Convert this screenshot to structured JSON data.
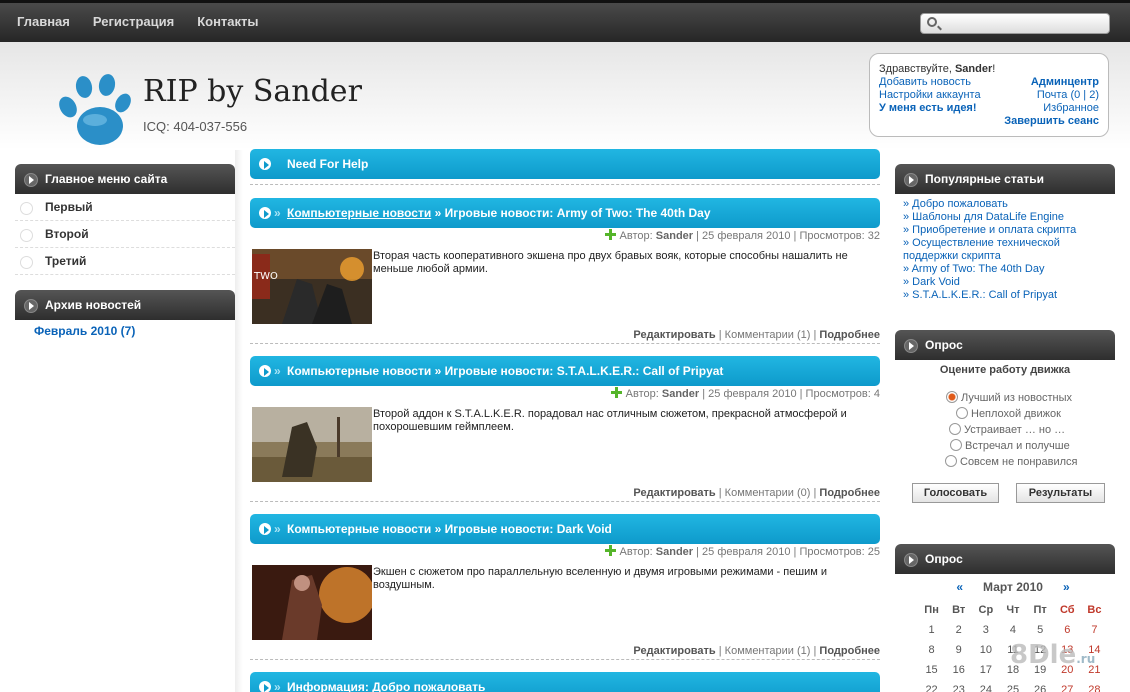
{
  "nav": {
    "items": [
      "Главная",
      "Регистрация",
      "Контакты"
    ],
    "search_placeholder": ""
  },
  "header": {
    "title": "RIP by Sander",
    "icq": "ICQ: 404-037-556"
  },
  "userbox": {
    "greeting": "Здравствуйте,",
    "user": "Sander",
    "excl": "!",
    "add_news": "Добавить новость",
    "account_settings": "Настройки аккаунта",
    "idea": "У меня есть идея!",
    "admin": "Админцентр",
    "mail": "Почта (0 | 2)",
    "favorites": "Избранное",
    "logout": "Завершить сеанс"
  },
  "left": {
    "main_menu_title": "Главное меню сайта",
    "menu": [
      "Первый",
      "Второй",
      "Третий"
    ],
    "archive_title": "Архив новостей",
    "archive_item": "Февраль 2010 (7)"
  },
  "center": {
    "need_help": "Need For Help",
    "posts": [
      {
        "category": "Компьютерные новости",
        "title": "» Игровые новости: Army of Two: The 40th Day",
        "author_label": "Автор:",
        "author": "Sander",
        "date": "| 25 февраля 2010 | Просмотров: 32",
        "text": "Вторая часть кооперативного экшена про двух бравых вояк, которые способны нашалить не меньше любой армии.",
        "edit": "Редактировать",
        "comments": "| Комментарии (1) |",
        "more": "Подробнее"
      },
      {
        "category": "Компьютерные новости",
        "title": "» Игровые новости: S.T.A.L.K.E.R.: Call of Pripyat",
        "author_label": "Автор:",
        "author": "Sander",
        "date": "| 25 февраля 2010 | Просмотров: 4",
        "text": "Второй аддон к S.T.A.L.K.E.R. порадовал нас отличным сюжетом, прекрасной атмосферой и похорошевшим геймплеем.",
        "edit": "Редактировать",
        "comments": "| Комментарии (0) |",
        "more": "Подробнее"
      },
      {
        "category": "Компьютерные новости",
        "title": "» Игровые новости: Dark Void",
        "author_label": "Автор:",
        "author": "Sander",
        "date": "| 25 февраля 2010 | Просмотров: 25",
        "text": "Экшен с сюжетом про параллельную вселенную и двумя игровыми режимами - пешим и воздушным.",
        "edit": "Редактировать",
        "comments": "| Комментарии (1) |",
        "more": "Подробнее"
      }
    ],
    "last_bar": "Информация: Добро пожаловать"
  },
  "right": {
    "popular_title": "Популярные статьи",
    "popular": [
      "» Добро пожаловать",
      "» Шаблоны для DataLife Engine",
      "» Приобретение и оплата скрипта",
      "» Осуществление технической поддержки скрипта",
      "» Army of Two: The 40th Day",
      "» Dark Void",
      "» S.T.A.L.K.E.R.: Call of Pripyat"
    ],
    "poll_title": "Опрос",
    "poll_question": "Оцените работу движка",
    "poll_options": [
      "Лучший из новостных",
      "Неплохой движок",
      "Устраивает … но …",
      "Встречал и получше",
      "Совсем не понравился"
    ],
    "vote": "Голосовать",
    "results": "Результаты",
    "calendar_title": "Опрос",
    "calendar": {
      "prev": "«",
      "month": "Март 2010",
      "next": "»",
      "days": [
        "Пн",
        "Вт",
        "Ср",
        "Чт",
        "Пт",
        "Сб",
        "Вс"
      ],
      "rows": [
        [
          "1",
          "2",
          "3",
          "4",
          "5",
          "6",
          "7"
        ],
        [
          "8",
          "9",
          "10",
          "11",
          "12",
          "13",
          "14"
        ],
        [
          "15",
          "16",
          "17",
          "18",
          "19",
          "20",
          "21"
        ],
        [
          "22",
          "23",
          "24",
          "25",
          "26",
          "27",
          "28"
        ]
      ]
    }
  },
  "watermark": {
    "text": "8Dle",
    "tld": ".ru"
  },
  "colors": {
    "accent": "#14a8d8",
    "link": "#0a63b8",
    "dark": "#3a3a3a"
  }
}
